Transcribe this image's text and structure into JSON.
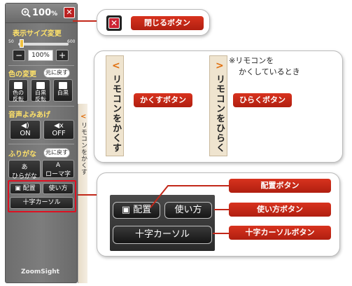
{
  "panel": {
    "zoom_display": "100",
    "zoom_unit": "%",
    "close_glyph": "✕",
    "display_size_label": "表示サイズ変更",
    "slider_min": "50",
    "slider_max": "600",
    "minus_label": "−",
    "plus_label": "+",
    "zoom_field": "100%",
    "color_label": "色の変更",
    "color_reset": "元に戻す",
    "color_buttons": [
      "色の\n反転",
      "白黒\n反転",
      "白黒"
    ],
    "voice_label": "音声よみあげ",
    "voice_on": "ON",
    "voice_off": "OFF",
    "furigana_label": "ふりがな",
    "furigana_reset": "元に戻す",
    "hiragana_btn": "ひらがな",
    "romaji_btn": "ローマ字",
    "hiragana_icon_char": "あ",
    "romaji_icon_char": "A",
    "layout_btn": "配置",
    "usage_btn": "使い方",
    "cursor_btn": "十字カーソル",
    "logo": "ZoomSight",
    "tab_text": "リモコンをかくす",
    "tab_chevron": "<"
  },
  "callouts": {
    "close_label": "閉じるボタン",
    "hide_strip_text": "リモコンをかくす",
    "show_strip_text": "リモコンをひらく",
    "hide_chevron": "<",
    "show_chevron": ">",
    "hide_label": "かくすボタン",
    "show_label": "ひらくボタン",
    "note_line1": "※リモコンを",
    "note_line2": "かくしているとき",
    "layout_btn": "配置",
    "usage_btn": "使い方",
    "cursor_btn": "十字カーソル",
    "layout_label": "配置ボタン",
    "usage_label": "使い方ボタン",
    "cursor_label": "十字カーソルボタン"
  },
  "colors": {
    "accent_red": "#c2281a",
    "yellow_label": "#ffe26a",
    "chevron_orange": "#e07010"
  }
}
